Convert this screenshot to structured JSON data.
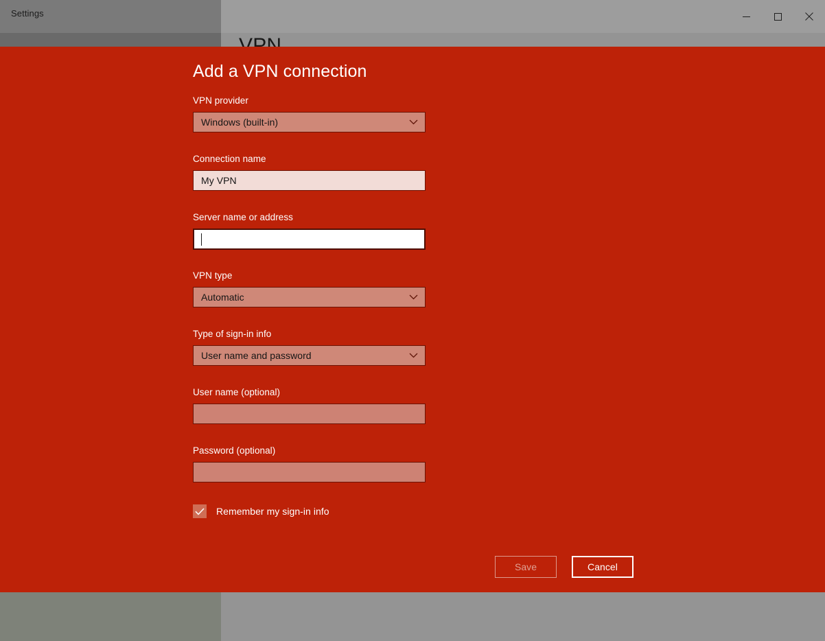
{
  "window": {
    "title": "Settings",
    "caption_buttons": [
      {
        "name": "minimize",
        "glyph": "minimize-icon"
      },
      {
        "name": "maximize",
        "glyph": "maximize-icon"
      },
      {
        "name": "close",
        "glyph": "close-icon"
      }
    ],
    "page_heading_behind": "VPN",
    "colors": {
      "titlebar": "#9d9d9d",
      "sidebar": "#7e8279",
      "content": "#949494",
      "accent_red": "#bd2208"
    }
  },
  "dialog": {
    "title": "Add a VPN connection",
    "fields": [
      {
        "label": "VPN provider",
        "type": "combo",
        "value": "Windows (built-in)",
        "placeholder": "",
        "name": "vpn-provider"
      },
      {
        "label": "Connection name",
        "type": "text-filled",
        "value": "My VPN",
        "placeholder": "",
        "name": "connection-name"
      },
      {
        "label": "Server name or address",
        "type": "text-focused",
        "value": "",
        "placeholder": "",
        "name": "server-name-or-address"
      },
      {
        "label": "VPN type",
        "type": "combo",
        "value": "Automatic",
        "placeholder": "",
        "name": "vpn-type"
      },
      {
        "label": "Type of sign-in info",
        "type": "combo",
        "value": "User name and password",
        "placeholder": "",
        "name": "type-of-sign-in-info"
      },
      {
        "label": "User name (optional)",
        "type": "text-empty",
        "value": "",
        "placeholder": "",
        "name": "user-name"
      },
      {
        "label": "Password (optional)",
        "type": "text-empty",
        "value": "",
        "placeholder": "",
        "name": "password"
      }
    ],
    "checkbox": {
      "label": "Remember my sign-in info",
      "checked": true
    },
    "buttons": {
      "save": {
        "label": "Save",
        "enabled": false
      },
      "cancel": {
        "label": "Cancel",
        "enabled": true
      }
    }
  }
}
